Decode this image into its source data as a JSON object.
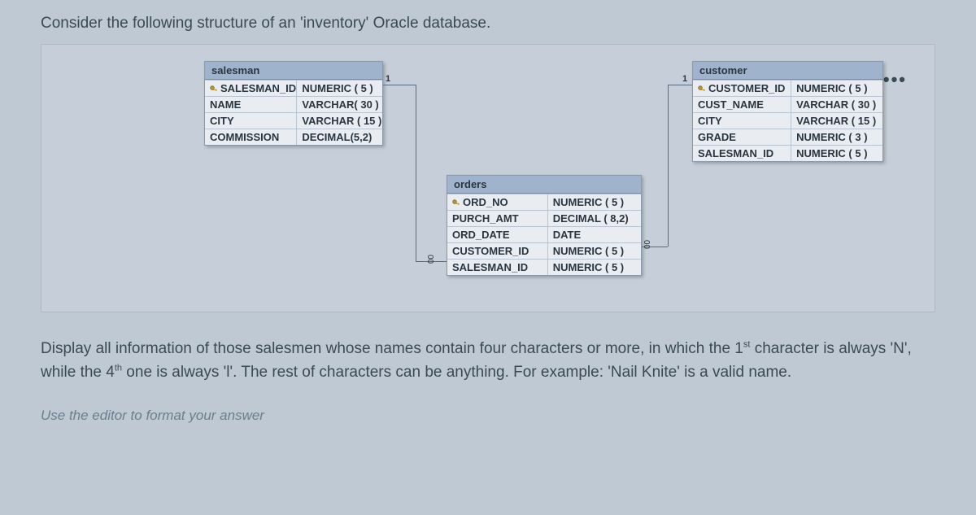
{
  "intro": "Consider the following structure of an 'inventory' Oracle database.",
  "more_icon_glyph": "•••",
  "tables": {
    "salesman": {
      "title": "salesman",
      "rows": [
        {
          "name": "SALESMAN_ID",
          "type": "NUMERIC ( 5 )",
          "pk": true
        },
        {
          "name": "NAME",
          "type": "VARCHAR( 30 )",
          "pk": false
        },
        {
          "name": "CITY",
          "type": "VARCHAR ( 15 )",
          "pk": false
        },
        {
          "name": "COMMISSION",
          "type": "DECIMAL(5,2)",
          "pk": false
        }
      ]
    },
    "orders": {
      "title": "orders",
      "rows": [
        {
          "name": "ORD_NO",
          "type": "NUMERIC ( 5 )",
          "pk": true
        },
        {
          "name": "PURCH_AMT",
          "type": "DECIMAL ( 8,2)",
          "pk": false
        },
        {
          "name": "ORD_DATE",
          "type": "DATE",
          "pk": false
        },
        {
          "name": "CUSTOMER_ID",
          "type": "NUMERIC ( 5 )",
          "pk": false
        },
        {
          "name": "SALESMAN_ID",
          "type": "NUMERIC ( 5 )",
          "pk": false
        }
      ]
    },
    "customer": {
      "title": "customer",
      "rows": [
        {
          "name": "CUSTOMER_ID",
          "type": "NUMERIC ( 5 )",
          "pk": true
        },
        {
          "name": "CUST_NAME",
          "type": "VARCHAR ( 30 )",
          "pk": false
        },
        {
          "name": "CITY",
          "type": "VARCHAR ( 15 )",
          "pk": false
        },
        {
          "name": "GRADE",
          "type": "NUMERIC ( 3 )",
          "pk": false
        },
        {
          "name": "SALESMAN_ID",
          "type": "NUMERIC ( 5 )",
          "pk": false
        }
      ]
    }
  },
  "connector_labels": {
    "one": "1",
    "many": "00"
  },
  "question_parts": {
    "p1": "Display all information of those salesmen whose names contain four characters or more, in which the 1",
    "sup1": "st",
    "p2": " character is always 'N', while the 4",
    "sup2": "th",
    "p3": " one is always 'l'. The rest of characters can be anything. For example: 'Nail Knite' is a valid name."
  },
  "editor_hint": "Use the editor to format your answer"
}
